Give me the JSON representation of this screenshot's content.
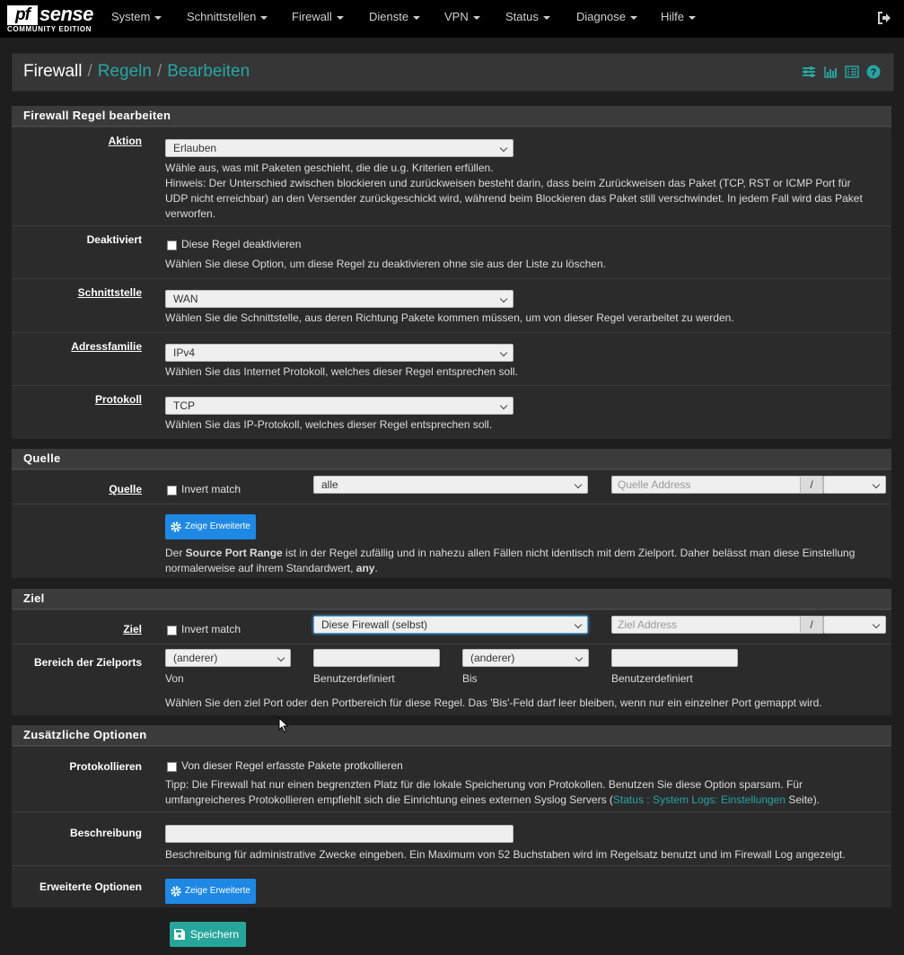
{
  "nav": {
    "logo_pf": "pf",
    "logo_sense": "sense",
    "logo_edition": "COMMUNITY EDITION",
    "items": [
      {
        "label": "System"
      },
      {
        "label": "Schnittstellen"
      },
      {
        "label": "Firewall"
      },
      {
        "label": "Dienste"
      },
      {
        "label": "VPN"
      },
      {
        "label": "Status"
      },
      {
        "label": "Diagnose"
      },
      {
        "label": "Hilfe"
      }
    ]
  },
  "breadcrumb": {
    "b0": "Firewall",
    "b1": "Regeln",
    "b2": "Bearbeiten",
    "sep": "/"
  },
  "colors": {
    "accent": "#28a4a4",
    "primary_button": "#1e88e5",
    "save_button": "#26a69a"
  },
  "edit": {
    "title": "Firewall Regel bearbeiten",
    "aktion_label": "Aktion",
    "aktion_value": "Erlauben",
    "aktion_help1": "Wähle aus, was mit Paketen geschieht, die die u.g. Kriterien erfüllen.",
    "aktion_help2": "Hinweis: Der Unterschied zwischen blockieren und zurückweisen besteht darin, dass beim Zurückweisen das Paket (TCP, RST or ICMP Port für UDP nicht erreichbar) an den Versender zurückgeschickt wird, während beim Blockieren das Paket still verschwindet. In jedem Fall wird das Paket verworfen.",
    "deakt_label": "Deaktiviert",
    "deakt_cb": "Diese Regel deaktivieren",
    "deakt_help": "Wählen Sie diese Option, um diese Regel zu deaktivieren ohne sie aus der Liste zu löschen.",
    "if_label": "Schnittstelle",
    "if_value": "WAN",
    "if_help": "Wählen Sie die Schnittstelle, aus deren Richtung Pakete kommen müssen, um von dieser Regel verarbeitet zu werden.",
    "af_label": "Adressfamilie",
    "af_value": "IPv4",
    "af_help": "Wählen Sie das Internet Protokoll, welches dieser Regel entsprechen soll.",
    "proto_label": "Protokoll",
    "proto_value": "TCP",
    "proto_help": "Wählen Sie das IP-Protokoll, welches dieser Regel entsprechen soll."
  },
  "source": {
    "title": "Quelle",
    "label": "Quelle",
    "invert": "Invert match",
    "type_value": "alle",
    "address_placeholder": "Quelle Address",
    "slash": "/",
    "adv_button": "Zeige Erweiterte",
    "help_pre": "Der ",
    "help_bold": "Source Port Range",
    "help_mid": " ist in der Regel zufällig und in nahezu allen Fällen nicht identisch mit dem Zielport. Daher belässt man diese Einstellung normalerweise auf ihrem Standardwert, ",
    "help_bold2": "any",
    "help_end": "."
  },
  "dest": {
    "title": "Ziel",
    "label": "Ziel",
    "invert": "Invert match",
    "type_value": "Diese Firewall (selbst)",
    "address_placeholder": "Ziel Address",
    "slash": "/",
    "ports_label": "Bereich der Zielports",
    "from_value": "(anderer)",
    "to_value": "(anderer)",
    "sub_von": "Von",
    "sub_custom1": "Benutzerdefiniert",
    "sub_bis": "Bis",
    "sub_custom2": "Benutzerdefiniert",
    "ports_help": "Wählen Sie den ziel Port oder den Portbereich für diese Regel. Das 'Bis'-Feld darf leer bleiben, wenn nur ein einzelner Port gemappt wird."
  },
  "extra": {
    "title": "Zusätzliche Optionen",
    "log_label": "Protokollieren",
    "log_cb": "Von dieser Regel erfasste Pakete protkollieren",
    "log_help_pre": "Tipp: Die Firewall hat nur einen begrenzten Platz für die lokale Speicherung von Protokollen. Benutzen Sie diese Option sparsam. Für umfangreicheres Protokollieren empfiehlt sich die Einrichtung eines externen Syslog Servers (",
    "log_help_link": "Status : System Logs: Einstellungen",
    "log_help_post": " Seite).",
    "desc_label": "Beschreibung",
    "desc_help": "Beschreibung für administrative Zwecke eingeben. Ein Maximum von 52 Buchstaben wird im Regelsatz benutzt und im Firewall Log angezeigt.",
    "adv_label": "Erweiterte Optionen",
    "adv_button": "Zeige Erweiterte"
  },
  "save_button": "Speichern"
}
